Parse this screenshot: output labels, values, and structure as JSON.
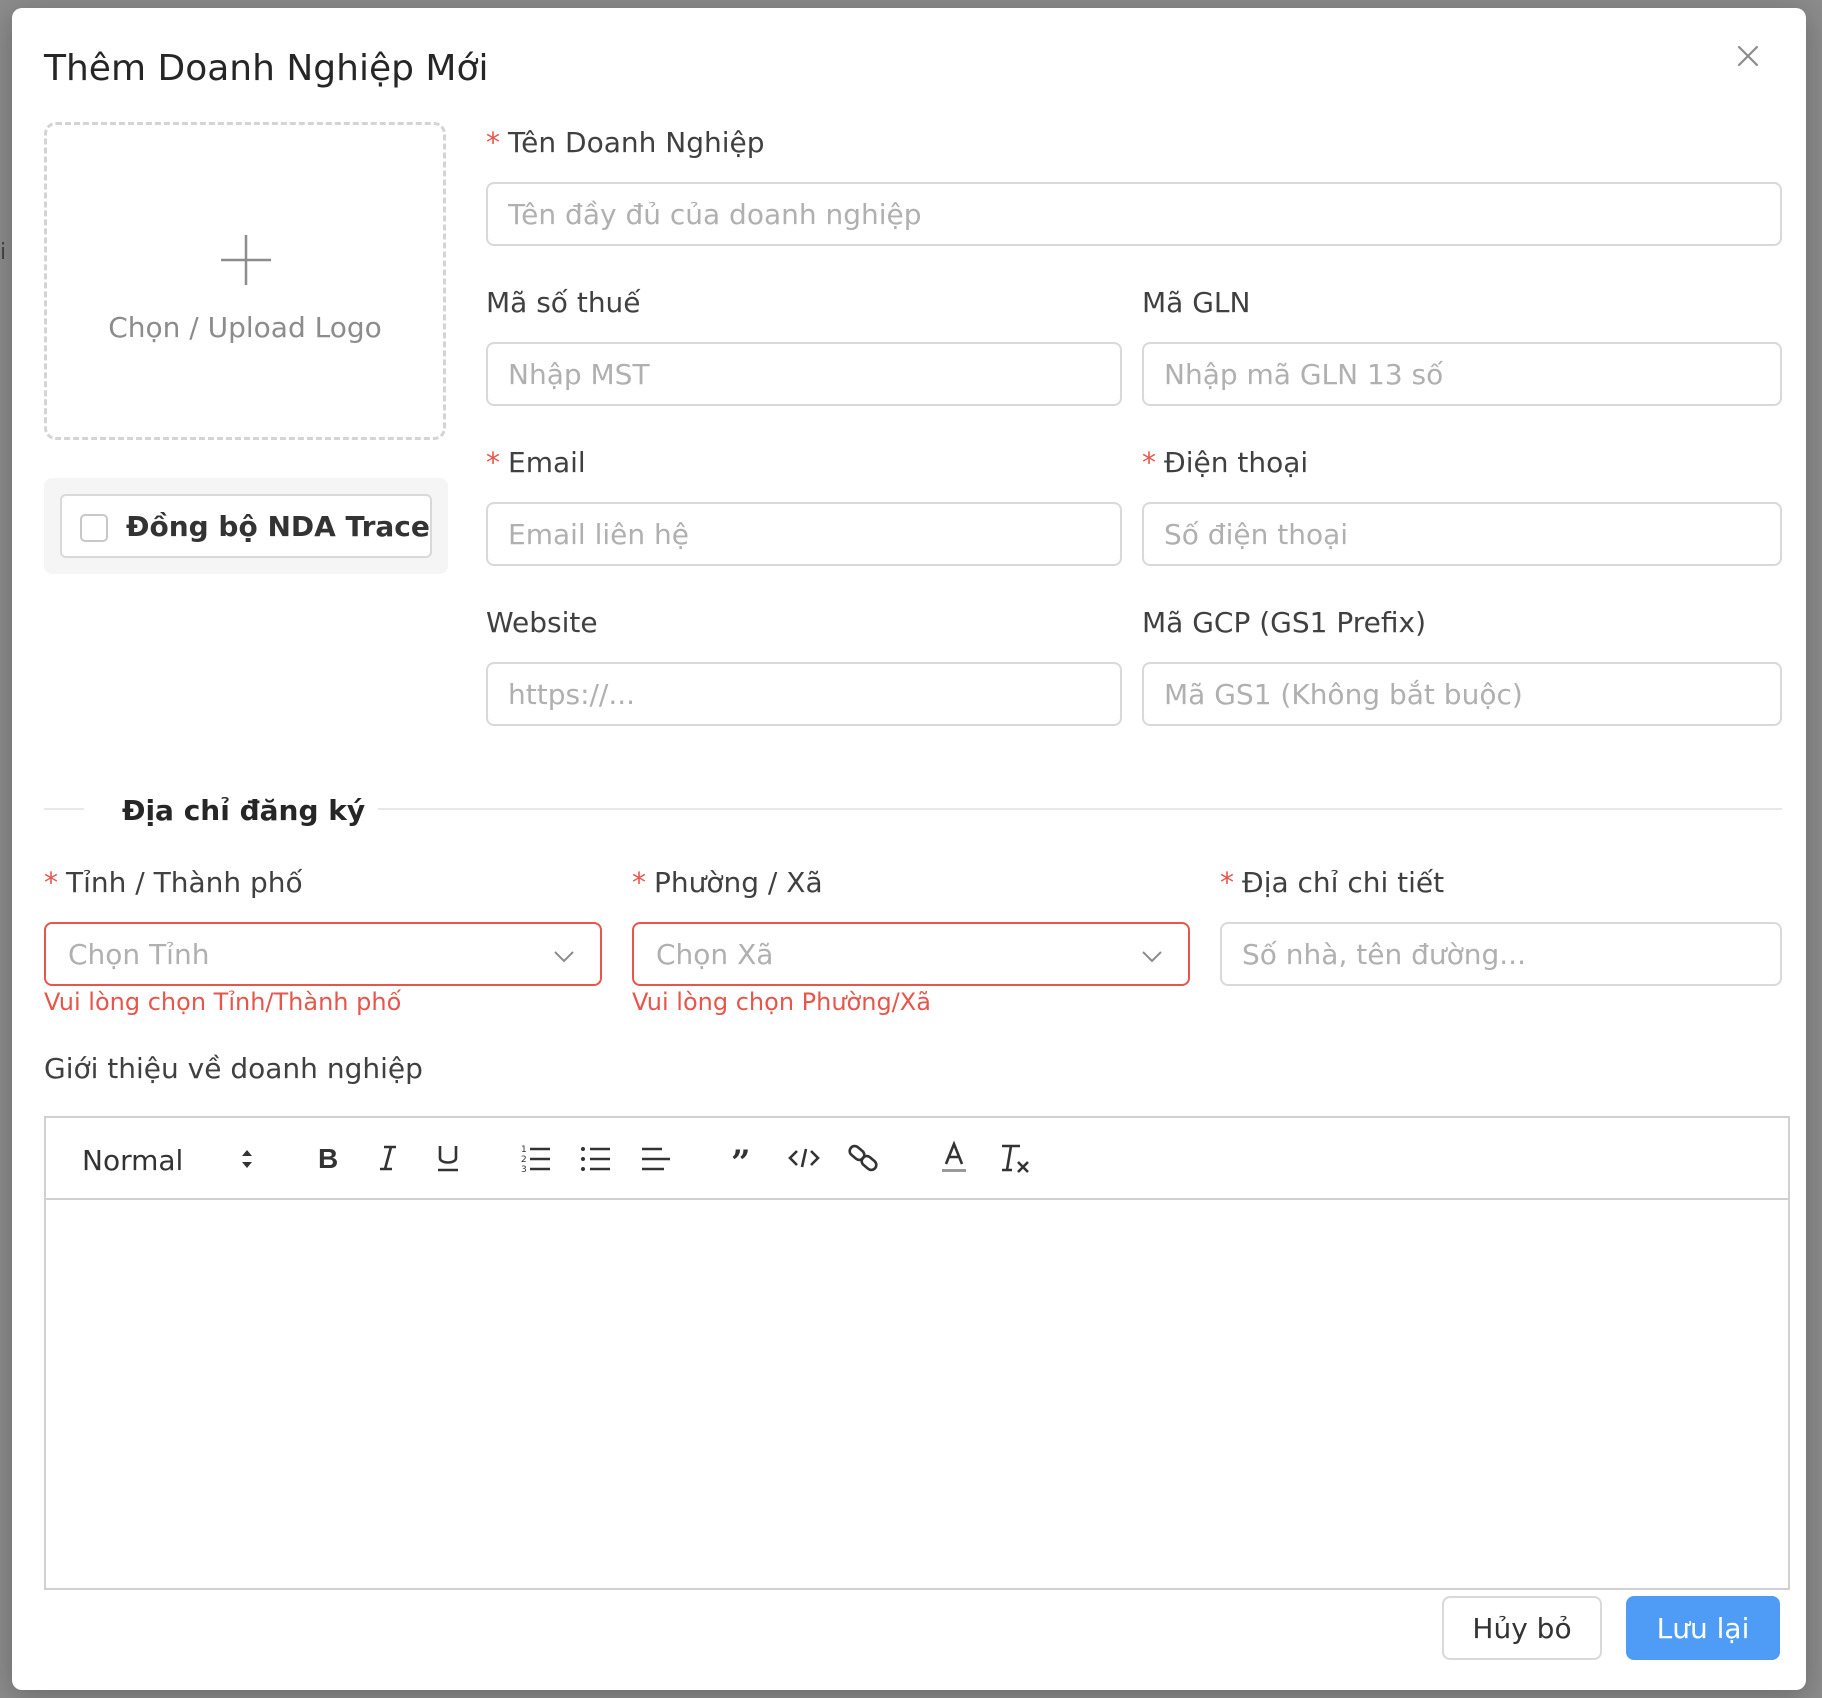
{
  "dialog": {
    "title": "Thêm Doanh Nghiệp Mới"
  },
  "logo": {
    "upload_label": "Chọn / Upload Logo"
  },
  "sync": {
    "label": "Đồng bộ NDA Trace",
    "checked": false
  },
  "fields": {
    "company_name": {
      "label": "Tên Doanh Nghiệp",
      "required": "*",
      "placeholder": "Tên đầy đủ của doanh nghiệp"
    },
    "tax_code": {
      "label": "Mã số thuế",
      "placeholder": "Nhập MST"
    },
    "gln": {
      "label": "Mã GLN",
      "placeholder": "Nhập mã GLN 13 số"
    },
    "email": {
      "label": "Email",
      "required": "*",
      "placeholder": "Email liên hệ"
    },
    "phone": {
      "label": "Điện thoại",
      "required": "*",
      "placeholder": "Số điện thoại"
    },
    "website": {
      "label": "Website",
      "placeholder": "https://..."
    },
    "gcp": {
      "label": "Mã GCP (GS1 Prefix)",
      "placeholder": "Mã GS1 (Không bắt buộc)"
    }
  },
  "address": {
    "section_title": "Địa chỉ đăng ký",
    "province": {
      "label": "Tỉnh / Thành phố",
      "required": "*",
      "placeholder": "Chọn Tỉnh",
      "error": "Vui lòng chọn Tỉnh/Thành phố"
    },
    "ward": {
      "label": "Phường / Xã",
      "required": "*",
      "placeholder": "Chọn Xã",
      "error": "Vui lòng chọn Phường/Xã"
    },
    "detail": {
      "label": "Địa chỉ chi tiết",
      "required": "*",
      "placeholder": "Số nhà, tên đường..."
    }
  },
  "intro": {
    "label": "Giới thiệu về doanh nghiệp",
    "toolbar": {
      "format": "Normal",
      "icons": [
        "bold-icon",
        "italic-icon",
        "underline-icon",
        "ordered-list-icon",
        "bullet-list-icon",
        "align-icon",
        "blockquote-icon",
        "code-icon",
        "link-icon",
        "text-color-icon",
        "clear-format-icon"
      ]
    }
  },
  "actions": {
    "cancel": "Hủy bỏ",
    "save": "Lưu lại"
  },
  "colors": {
    "primary": "#4e9cf5",
    "error": "#e8554a",
    "border": "#d9d9d9"
  }
}
